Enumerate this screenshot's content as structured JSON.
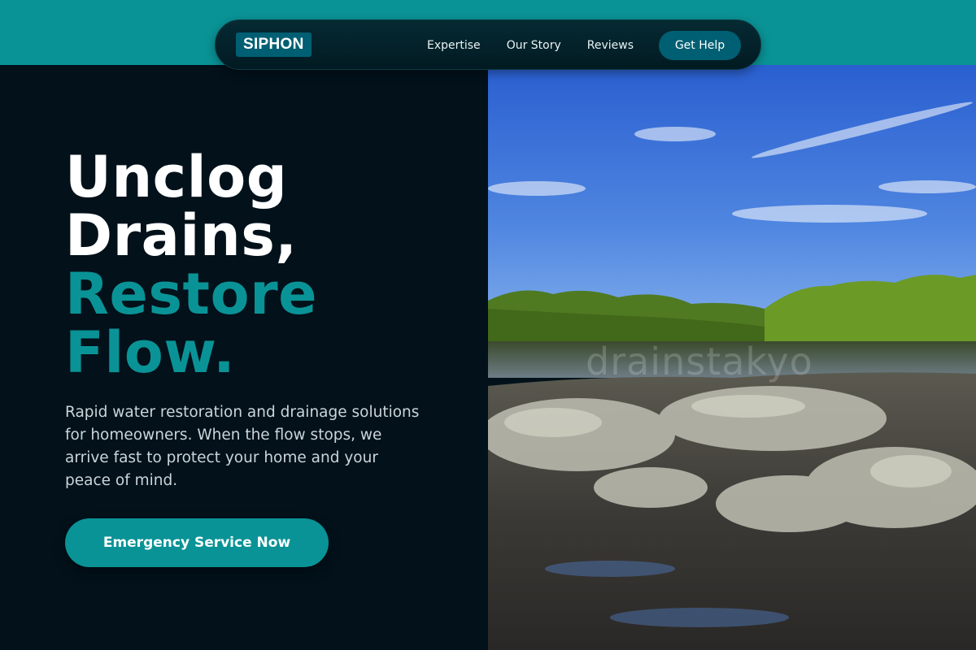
{
  "brand": {
    "logo_text": "SIPHON"
  },
  "nav": {
    "links": [
      {
        "label": "Expertise"
      },
      {
        "label": "Our Story"
      },
      {
        "label": "Reviews"
      }
    ],
    "cta_label": "Get Help"
  },
  "hero": {
    "headline_line1": "Unclog",
    "headline_line2": "Drains,",
    "headline_line3": "Restore",
    "headline_line4": "Flow.",
    "description": "Rapid water restoration and drainage solutions for homeowners. When the flow stops, we arrive fast to protect your home and your peace of mind.",
    "cta_label": "Emergency Service Now",
    "image": {
      "watermark_text": "drainstakyo"
    }
  },
  "colors": {
    "accent": "#0a9396",
    "dark_background": "#02111a",
    "brand_dark": "#005f73",
    "text_light": "#c9d6da"
  }
}
